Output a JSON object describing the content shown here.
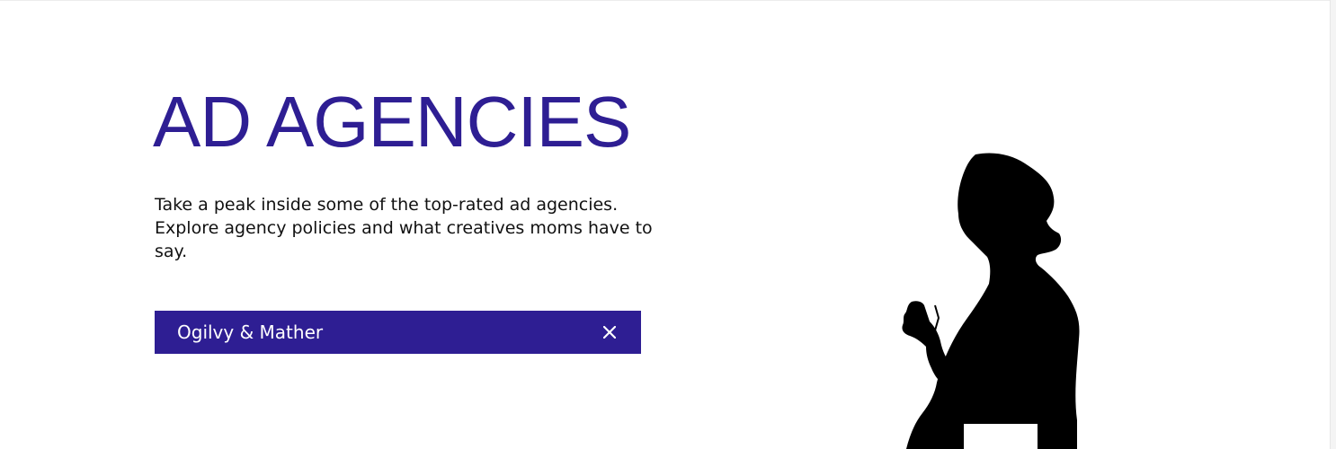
{
  "hero": {
    "title": "AD AGENCIES",
    "description": "Take a peak inside some of the top-rated ad agencies. Explore agency policies and what creatives moms have to say."
  },
  "filter": {
    "selected_agency": "Ogilvy & Mather",
    "clear_icon": "close-icon"
  },
  "illustration": {
    "subject": "silhouette of a woman holding a phone"
  },
  "colors": {
    "brand": "#2e1e93",
    "background": "#ffffff",
    "text": "#111111",
    "filter_text": "#ffffff"
  }
}
